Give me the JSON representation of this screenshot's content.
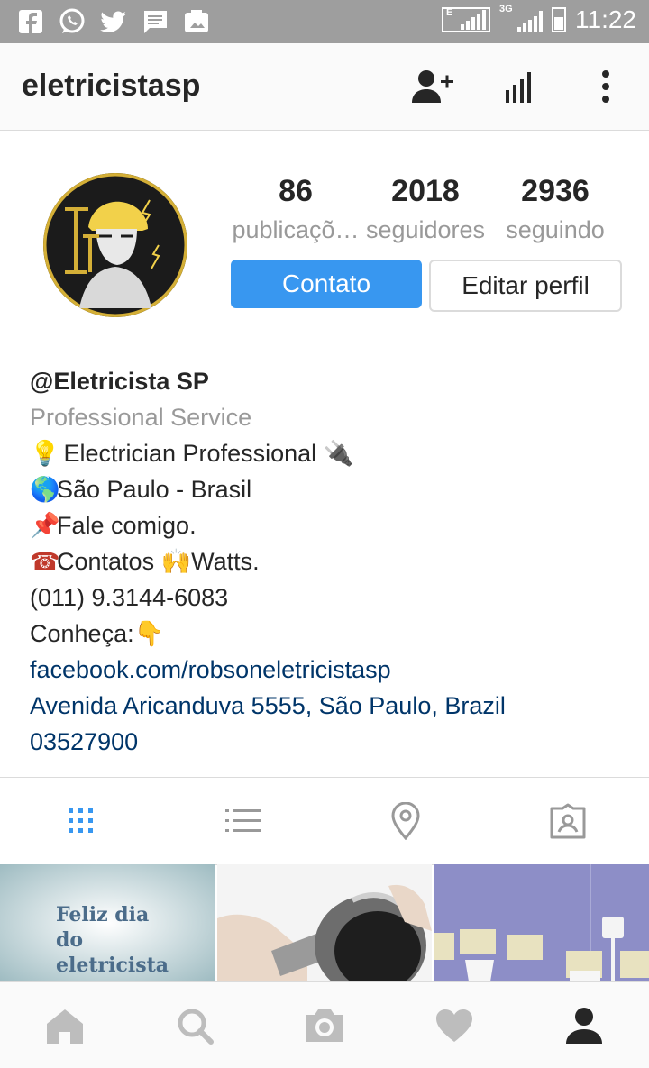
{
  "status_bar": {
    "icons": [
      "facebook-icon",
      "whatsapp-icon",
      "twitter-icon",
      "message-icon",
      "photo-icon"
    ],
    "signal_labels": [
      "E",
      "3G"
    ],
    "time": "11:22"
  },
  "app_bar": {
    "title": "eletricistasp",
    "actions": [
      "add-person-icon",
      "stats-icon",
      "more-icon"
    ]
  },
  "profile": {
    "stats": [
      {
        "value": "86",
        "label": "publicaçõ…"
      },
      {
        "value": "2018",
        "label": "seguidores"
      },
      {
        "value": "2936",
        "label": "seguindo"
      }
    ],
    "primary_button": "Contato",
    "secondary_button": "Editar perfil"
  },
  "bio": {
    "name": "@Eletricista SP",
    "category": "Professional Service",
    "lines": [
      {
        "emoji": "💡",
        "text": "  Electrician Professional 🔌"
      },
      {
        "emoji": "🌎",
        "text": "São Paulo - Brasil"
      },
      {
        "emoji": "📌",
        "text": "Fale comigo."
      },
      {
        "emoji": "☎",
        "text": "Contatos  🙌Watts."
      },
      {
        "emoji": "",
        "text": "(011) 9.3144-6083"
      },
      {
        "emoji": "",
        "text": "Conheça:👇"
      }
    ],
    "link": "facebook.com/robsoneletricistasp",
    "address_line1": "Avenida Aricanduva 5555, São Paulo, Brazil",
    "address_line2": "03527900"
  },
  "tabs": [
    "grid-icon",
    "list-icon",
    "location-icon",
    "tagged-icon"
  ],
  "photos": [
    {
      "text": "Feliz dia do eletricista",
      "bg": "#d9e6e9"
    },
    {
      "text": "",
      "bg": "#f2f2f2"
    },
    {
      "text": "",
      "bg": "#8e8fc8"
    }
  ],
  "bottom_nav": [
    "home-icon",
    "search-icon",
    "camera-icon",
    "heart-icon",
    "profile-icon"
  ],
  "colors": {
    "accent": "#3897f0",
    "link": "#003569",
    "status_bar": "#9e9e9e"
  }
}
